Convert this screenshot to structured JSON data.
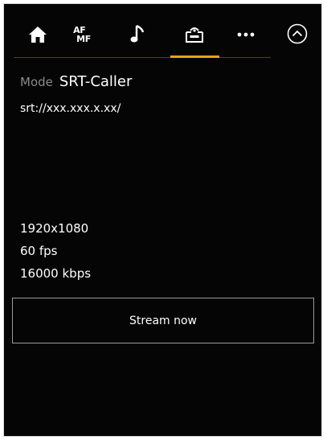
{
  "toolbar": {
    "tabs": [
      {
        "icon": "home-icon"
      },
      {
        "icon": "af-mf-icon",
        "line1": "AF",
        "line2": "MF"
      },
      {
        "icon": "music-note-icon"
      },
      {
        "icon": "streaming-icon",
        "active": true
      },
      {
        "icon": "more-icon"
      }
    ],
    "collapse_icon": "chevron-up-circle-icon",
    "accent_color": "#e6a31a"
  },
  "stream": {
    "mode_label": "Mode",
    "mode_value": "SRT-Caller",
    "url": "srt://xxx.xxx.x.xx/",
    "resolution": "1920x1080",
    "frame_rate": "60 fps",
    "bitrate": "16000 kbps",
    "button_label": "Stream now"
  }
}
